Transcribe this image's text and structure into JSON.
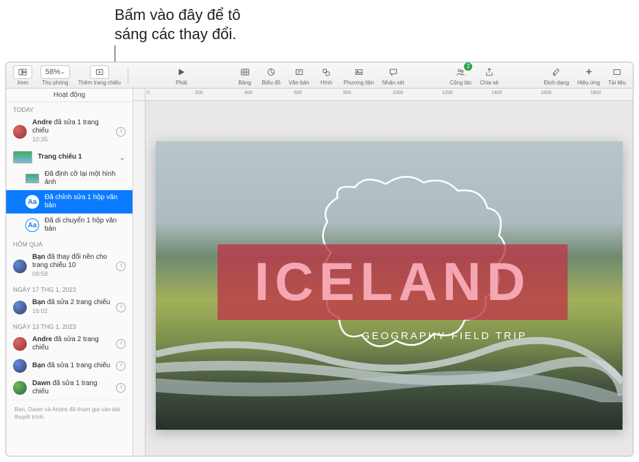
{
  "callout": "Bấm vào đây để tô\nsáng các thay đổi.",
  "toolbar": {
    "view": "Xem",
    "zoom": "Thu phóng",
    "zoom_value": "58%",
    "add_slide": "Thêm trang chiếu",
    "play": "Phát",
    "table": "Bảng",
    "chart": "Biểu đồ",
    "text": "Văn bản",
    "shape": "Hình",
    "media": "Phương tiện",
    "comment": "Nhận xét",
    "collab": "Cộng tác",
    "share": "Chia sẻ",
    "format": "Định dạng",
    "effects": "Hiệu ứng",
    "document": "Tài liệu"
  },
  "sidebar": {
    "title": "Hoạt động",
    "sections": {
      "today": "TODAY",
      "yesterday": "Hôm qua",
      "jan17": "ngày 17 Thg 1, 2023",
      "jan13": "ngày 13 Thg 1, 2023"
    },
    "items": {
      "andre_edit": {
        "who": "Andre",
        "what": " đã sửa 1 trang chiếu",
        "time": "10:35"
      },
      "slide1": "Trang chiếu 1",
      "resized_img": "Đã định cỡ lại một hình ảnh",
      "edited_textbox": "Đã chỉnh sửa 1 hộp văn bản",
      "moved_textbox": "Đã di chuyển 1 hộp văn bản",
      "yesterday_item": {
        "who": "Bạn",
        "what": " đã thay đổi nền cho trang chiếu 10",
        "time": "09:58"
      },
      "jan17_item": {
        "who": "Bạn",
        "what": " đã sửa 2 trang chiếu",
        "time": "16:02"
      },
      "jan13_a": {
        "who": "Andre",
        "what": " đã sửa 2 trang chiếu"
      },
      "jan13_b": {
        "who": "Bạn",
        "what": " đã sửa 1 trang chiếu"
      },
      "jan13_c": {
        "who": "Dawn",
        "what": " đã sửa 1 trang chiếu"
      }
    },
    "footnote": "Bạn, Dawn và Andre đã tham gia vào bài thuyết trình."
  },
  "slide": {
    "title": "ICELAND",
    "subtitle": "GEOGRAPHY FIELD TRIP"
  },
  "ruler": {
    "marks": [
      "0",
      "200",
      "400",
      "600",
      "800",
      "1000",
      "1200",
      "1400",
      "1600",
      "1800"
    ]
  }
}
